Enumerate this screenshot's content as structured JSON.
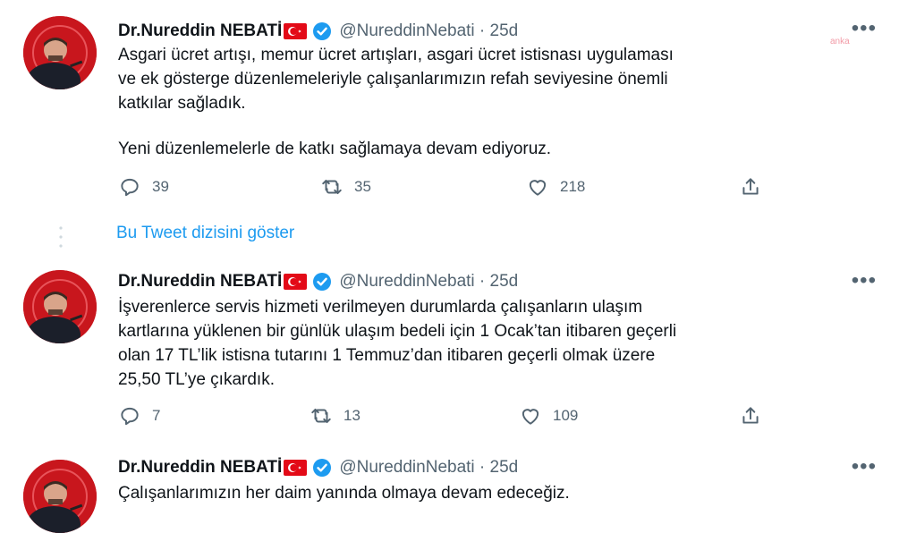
{
  "watermark": "anka",
  "tweets": [
    {
      "name": "Dr.Nureddin NEBATİ",
      "handle": "@NureddinNebati · 25d",
      "lines": [
        "Asgari ücret artışı, memur ücret artışları, asgari ücret istisnası uygulaması",
        "ve ek gösterge düzenlemeleriyle çalışanlarımızın refah seviyesine önemli",
        "katkılar sağladık.",
        "",
        "Yeni düzenlemelerle de katkı sağlamaya devam ediyoruz."
      ],
      "replies": "39",
      "retweets": "35",
      "likes": "218"
    },
    {
      "name": "Dr.Nureddin NEBATİ",
      "handle": "@NureddinNebati · 25d",
      "lines": [
        "İşverenlerce servis hizmeti verilmeyen durumlarda çalışanların ulaşım",
        "kartlarına yüklenen bir günlük ulaşım bedeli için 1 Ocak’tan itibaren geçerli",
        "olan 17 TL’lik istisna tutarını 1 Temmuz’dan itibaren geçerli olmak üzere",
        "25,50 TL’ye çıkardık."
      ],
      "replies": "7",
      "retweets": "13",
      "likes": "109"
    },
    {
      "name": "Dr.Nureddin NEBATİ",
      "handle": "@NureddinNebati · 25d",
      "lines": [
        "Çalışanlarımızın her daim yanında olmaya devam edeceğiz."
      ]
    }
  ],
  "show_thread": "Bu Tweet dizisini göster",
  "colors": {
    "accent": "#1d9bf0",
    "muted": "#536471",
    "text": "#0f1419",
    "flag_red": "#e30a17"
  }
}
